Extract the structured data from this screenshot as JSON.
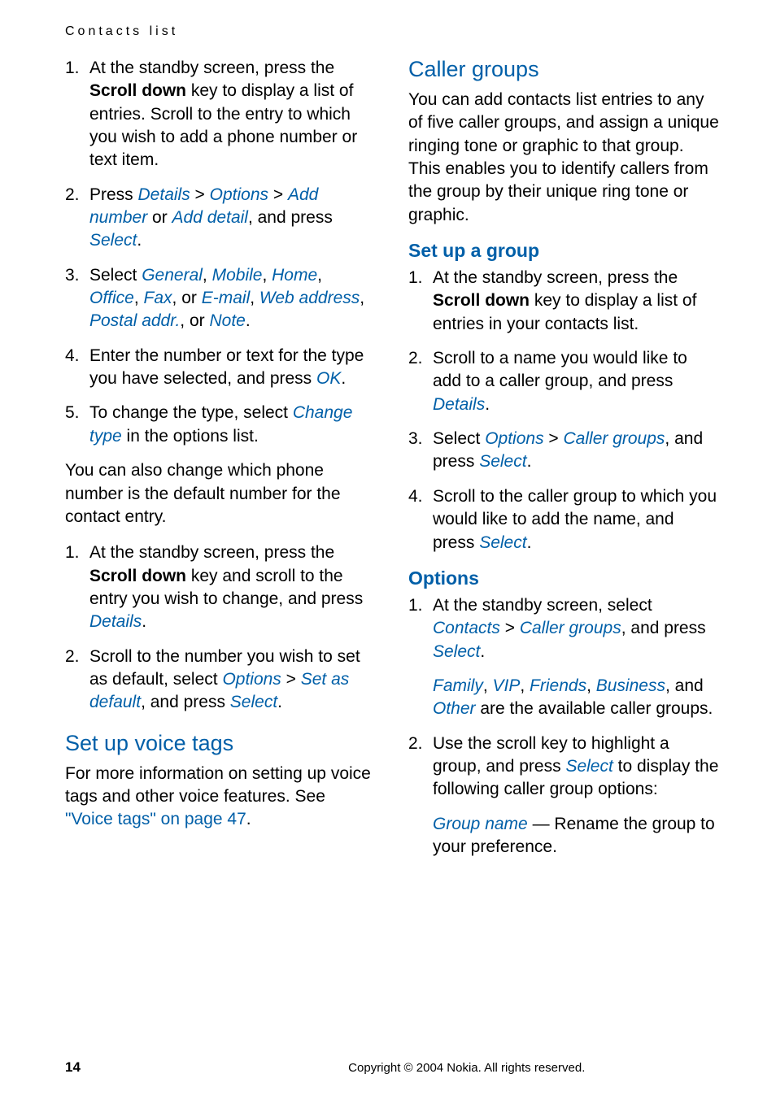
{
  "header": {
    "title": "Contacts list"
  },
  "left": {
    "stepsA": [
      {
        "num": "1.",
        "parts": [
          {
            "t": "At the standby screen, press the "
          },
          {
            "t": "Scroll down",
            "cls": "bold"
          },
          {
            "t": " key to display a list of entries. Scroll to the entry to which you wish to add a phone number or text item."
          }
        ]
      },
      {
        "num": "2.",
        "parts": [
          {
            "t": "Press "
          },
          {
            "t": "Details",
            "cls": "accent"
          },
          {
            "t": " > "
          },
          {
            "t": "Options",
            "cls": "accent"
          },
          {
            "t": " > "
          },
          {
            "t": "Add number",
            "cls": "accent"
          },
          {
            "t": " or "
          },
          {
            "t": "Add detail",
            "cls": "accent"
          },
          {
            "t": ", and press "
          },
          {
            "t": "Select",
            "cls": "accent"
          },
          {
            "t": "."
          }
        ]
      },
      {
        "num": "3.",
        "parts": [
          {
            "t": "Select "
          },
          {
            "t": "General",
            "cls": "accent"
          },
          {
            "t": ", "
          },
          {
            "t": "Mobile",
            "cls": "accent"
          },
          {
            "t": ", "
          },
          {
            "t": "Home",
            "cls": "accent"
          },
          {
            "t": ", "
          },
          {
            "t": "Office",
            "cls": "accent"
          },
          {
            "t": ", "
          },
          {
            "t": "Fax",
            "cls": "accent"
          },
          {
            "t": ", or "
          },
          {
            "t": "E-mail",
            "cls": "accent"
          },
          {
            "t": ", "
          },
          {
            "t": "Web address",
            "cls": "accent"
          },
          {
            "t": ", "
          },
          {
            "t": "Postal addr.",
            "cls": "accent"
          },
          {
            "t": ", or "
          },
          {
            "t": "Note",
            "cls": "accent"
          },
          {
            "t": "."
          }
        ]
      },
      {
        "num": "4.",
        "parts": [
          {
            "t": "Enter the number or text for the type you have selected, and press "
          },
          {
            "t": "OK",
            "cls": "accent"
          },
          {
            "t": "."
          }
        ]
      },
      {
        "num": "5.",
        "parts": [
          {
            "t": "To change the type, select "
          },
          {
            "t": "Change type",
            "cls": "accent"
          },
          {
            "t": " in the options list."
          }
        ]
      }
    ],
    "mid_para": "You can also change which phone number is the default number for the contact entry.",
    "stepsB": [
      {
        "num": "1.",
        "parts": [
          {
            "t": "At the standby screen, press the "
          },
          {
            "t": "Scroll down",
            "cls": "bold"
          },
          {
            "t": " key and scroll to the entry you wish to change, and press "
          },
          {
            "t": "Details",
            "cls": "accent"
          },
          {
            "t": "."
          }
        ]
      },
      {
        "num": "2.",
        "parts": [
          {
            "t": "Scroll to the number you wish to set as default, select "
          },
          {
            "t": "Options",
            "cls": "accent"
          },
          {
            "t": " > "
          },
          {
            "t": "Set as default",
            "cls": "accent"
          },
          {
            "t": ", and press "
          },
          {
            "t": "Select",
            "cls": "accent"
          },
          {
            "t": "."
          }
        ]
      }
    ],
    "voice_heading": "Set up voice tags",
    "voice_para_parts": [
      {
        "t": "For more information on setting up voice tags and other voice features. See "
      },
      {
        "t": "\"Voice tags\" on page 47",
        "cls": "link"
      },
      {
        "t": "."
      }
    ]
  },
  "right": {
    "caller_heading": "Caller groups",
    "caller_intro": "You can add contacts list entries to any of five caller groups, and assign a unique ringing tone or graphic to that group. This enables you to identify callers from the group by their unique ring tone or graphic.",
    "setup_heading": "Set up a group",
    "setup_steps": [
      {
        "num": "1.",
        "parts": [
          {
            "t": "At the standby screen, press the "
          },
          {
            "t": "Scroll down",
            "cls": "bold"
          },
          {
            "t": " key to display a list of entries in your contacts list."
          }
        ]
      },
      {
        "num": "2.",
        "parts": [
          {
            "t": "Scroll to a name you would like to add to a caller group, and press "
          },
          {
            "t": "Details",
            "cls": "accent"
          },
          {
            "t": "."
          }
        ]
      },
      {
        "num": "3.",
        "parts": [
          {
            "t": "Select "
          },
          {
            "t": "Options",
            "cls": "accent"
          },
          {
            "t": " > "
          },
          {
            "t": "Caller groups",
            "cls": "accent"
          },
          {
            "t": ", and press "
          },
          {
            "t": "Select",
            "cls": "accent"
          },
          {
            "t": "."
          }
        ]
      },
      {
        "num": "4.",
        "parts": [
          {
            "t": "Scroll to the caller group to which you would like to add the name, and press "
          },
          {
            "t": "Select",
            "cls": "accent"
          },
          {
            "t": "."
          }
        ]
      }
    ],
    "options_heading": "Options",
    "options_steps": [
      {
        "num": "1.",
        "body_parts": [
          {
            "t": "At the standby screen, select "
          },
          {
            "t": "Contacts",
            "cls": "accent"
          },
          {
            "t": " > "
          },
          {
            "t": "Caller groups",
            "cls": "accent"
          },
          {
            "t": ", and press "
          },
          {
            "t": "Select",
            "cls": "accent"
          },
          {
            "t": "."
          }
        ],
        "sub_parts": [
          {
            "t": "Family",
            "cls": "accent"
          },
          {
            "t": ", "
          },
          {
            "t": "VIP",
            "cls": "accent"
          },
          {
            "t": ", "
          },
          {
            "t": "Friends",
            "cls": "accent"
          },
          {
            "t": ", "
          },
          {
            "t": "Business",
            "cls": "accent"
          },
          {
            "t": ", and "
          },
          {
            "t": "Other",
            "cls": "accent"
          },
          {
            "t": " are the available caller groups."
          }
        ]
      },
      {
        "num": "2.",
        "body_parts": [
          {
            "t": "Use the scroll key to highlight a group, and press "
          },
          {
            "t": "Select",
            "cls": "accent"
          },
          {
            "t": " to display the following caller group options:"
          }
        ],
        "sub_parts": [
          {
            "t": "Group name",
            "cls": "accent"
          },
          {
            "t": " — Rename the group to your preference."
          }
        ]
      }
    ]
  },
  "footer": {
    "page": "14",
    "copyright": "Copyright © 2004 Nokia. All rights reserved."
  }
}
